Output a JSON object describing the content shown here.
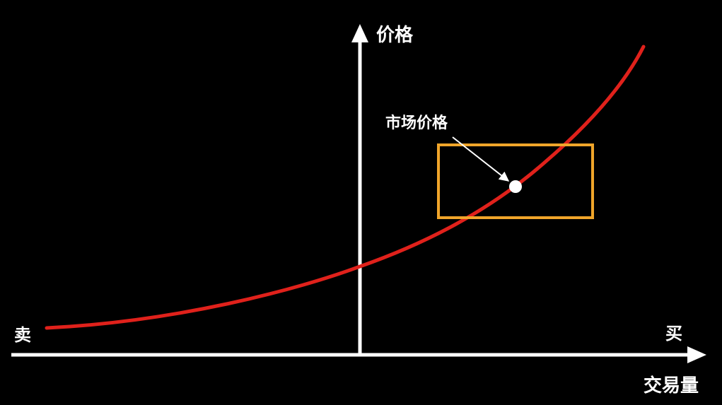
{
  "labels": {
    "y_axis": "价格",
    "x_axis": "交易量",
    "sell": "卖",
    "buy": "买",
    "callout": "市场价格"
  },
  "colors": {
    "background": "#000000",
    "axis": "#ffffff",
    "curve": "#e0211b",
    "range_box": "#f0a52a",
    "market_point": "#ffffff",
    "text": "#ffffff"
  },
  "icons": {
    "y_axis_arrow": "arrow-up-icon",
    "x_axis_arrow": "arrow-right-icon",
    "callout_arrow": "arrow-down-right-icon"
  }
}
